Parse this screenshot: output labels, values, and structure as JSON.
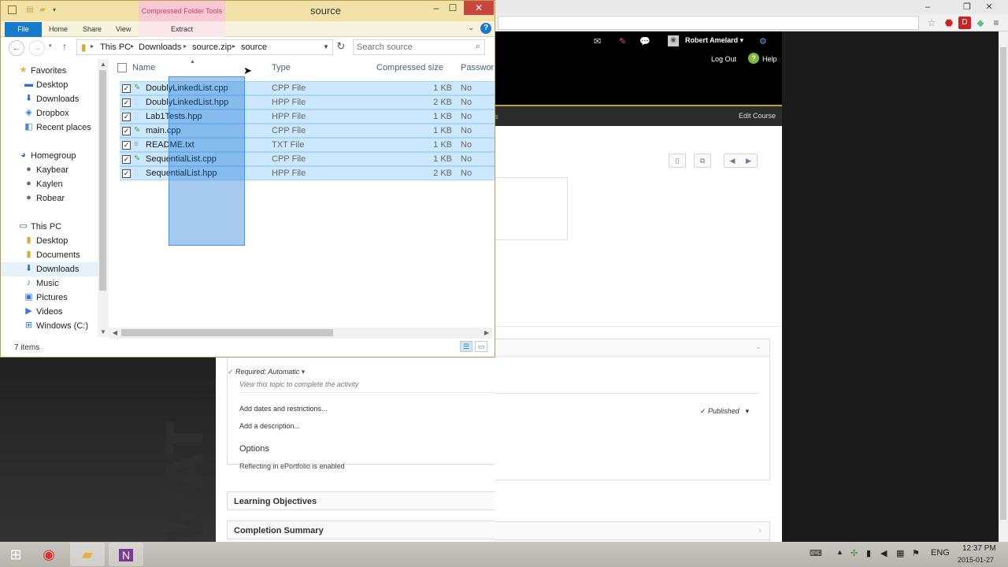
{
  "explorer": {
    "title": "source",
    "context_tab": "Compressed Folder Tools",
    "ribbon": {
      "file": "File",
      "home": "Home",
      "share": "Share",
      "view": "View",
      "extract": "Extract"
    },
    "breadcrumb": [
      "This PC",
      "Downloads",
      "source.zip",
      "source"
    ],
    "search_placeholder": "Search source",
    "nav": {
      "favorites": "Favorites",
      "fav_items": [
        "Desktop",
        "Downloads",
        "Dropbox",
        "Recent places"
      ],
      "homegroup": "Homegroup",
      "home_items": [
        "Kaybear",
        "Kaylen",
        "Robear"
      ],
      "thispc": "This PC",
      "pc_items": [
        "Desktop",
        "Documents",
        "Downloads",
        "Music",
        "Pictures",
        "Videos",
        "Windows (C:)"
      ]
    },
    "columns": {
      "name": "Name",
      "type": "Type",
      "compressed_size": "Compressed size",
      "password": "Passwor"
    },
    "files": [
      {
        "name": "DoublyLinkedList.cpp",
        "type": "CPP File",
        "size": "1 KB",
        "password": "No"
      },
      {
        "name": "DoublyLinkedList.hpp",
        "type": "HPP File",
        "size": "2 KB",
        "password": "No"
      },
      {
        "name": "Lab1Tests.hpp",
        "type": "HPP File",
        "size": "1 KB",
        "password": "No"
      },
      {
        "name": "main.cpp",
        "type": "CPP File",
        "size": "1 KB",
        "password": "No"
      },
      {
        "name": "README.txt",
        "type": "TXT File",
        "size": "1 KB",
        "password": "No"
      },
      {
        "name": "SequentialList.cpp",
        "type": "CPP File",
        "size": "1 KB",
        "password": "No"
      },
      {
        "name": "SequentialList.hpp",
        "type": "HPP File",
        "size": "2 KB",
        "password": "No"
      }
    ],
    "status": "7 items"
  },
  "lms": {
    "user": "Robert Amelard ▾",
    "logout": "Log Out",
    "help": "Help",
    "nav_s": "s",
    "edit_course": "Edit Course",
    "required": "Required: Automatic",
    "required_sub": "View this topic to complete the activity",
    "add_dates": "Add dates and restrictions...",
    "published": "Published",
    "add_description": "Add a description...",
    "options": "Options",
    "reflecting": "Reflecting in ePortfolio is enabled",
    "learning_objectives": "Learning Objectives",
    "completion_summary": "Completion Summary"
  },
  "taskbar": {
    "lang": "ENG",
    "time": "12:37 PM",
    "date": "2015-01-27"
  }
}
